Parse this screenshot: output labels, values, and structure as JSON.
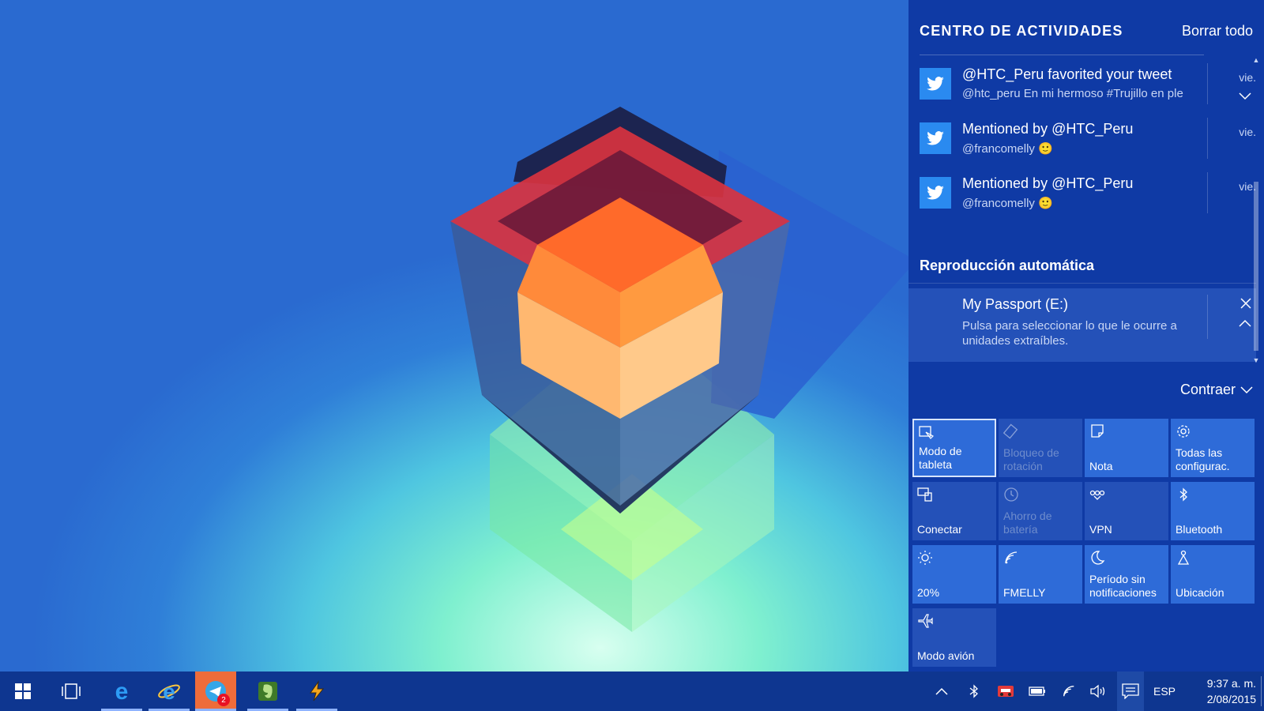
{
  "action_center": {
    "title": "CENTRO DE ACTIVIDADES",
    "clear_all": "Borrar todo",
    "notifications": [
      {
        "app_icon": "twitter-icon",
        "title": "@HTC_Peru favorited your tweet",
        "body": "@htc_peru En mi hermoso #Trujillo en ple",
        "time": "vie."
      },
      {
        "app_icon": "twitter-icon",
        "title": "Mentioned by @HTC_Peru",
        "body": "@francomelly 🙂",
        "time": "vie."
      },
      {
        "app_icon": "twitter-icon",
        "title": "Mentioned by @HTC_Peru",
        "body": "@francomelly 🙂",
        "time": "vie."
      }
    ],
    "autoplay_section": "Reproducción automática",
    "autoplay": {
      "title": "My Passport (E:)",
      "body": "Pulsa para seleccionar lo que le ocurre a unidades extraíbles."
    },
    "collapse": "Contraer",
    "quick_actions": [
      {
        "label": "Modo de tableta",
        "icon": "tablet-mode-icon",
        "state": "on"
      },
      {
        "label": "Bloqueo de rotación",
        "icon": "rotation-lock-icon",
        "state": "disabled"
      },
      {
        "label": "Nota",
        "icon": "note-icon",
        "state": "on"
      },
      {
        "label": "Todas las configurac.",
        "icon": "settings-gear-icon",
        "state": "on"
      },
      {
        "label": "Conectar",
        "icon": "connect-icon",
        "state": "off"
      },
      {
        "label": "Ahorro de batería",
        "icon": "battery-saver-icon",
        "state": "disabled"
      },
      {
        "label": "VPN",
        "icon": "vpn-icon",
        "state": "off"
      },
      {
        "label": "Bluetooth",
        "icon": "bluetooth-icon",
        "state": "on"
      },
      {
        "label": "20%",
        "icon": "brightness-icon",
        "state": "on"
      },
      {
        "label": "FMELLY",
        "icon": "wifi-icon",
        "state": "on"
      },
      {
        "label": "Período sin notificaciones",
        "icon": "quiet-hours-moon-icon",
        "state": "on"
      },
      {
        "label": "Ubicación",
        "icon": "location-icon",
        "state": "on"
      },
      {
        "label": "Modo avión",
        "icon": "airplane-icon",
        "state": "off"
      }
    ]
  },
  "taskbar": {
    "apps": [
      {
        "name": "start-button",
        "icon": "windows-logo-icon"
      },
      {
        "name": "task-view-button",
        "icon": "task-view-icon"
      },
      {
        "name": "edge",
        "icon": "edge-icon"
      },
      {
        "name": "internet-explorer",
        "icon": "internet-explorer-icon"
      },
      {
        "name": "telegram",
        "icon": "telegram-icon",
        "badge": "2"
      },
      {
        "name": "evernote",
        "icon": "evernote-icon"
      },
      {
        "name": "winamp",
        "icon": "winamp-icon"
      }
    ],
    "language": "ESP",
    "time": "9:37 a. m.",
    "date": "2/08/2015"
  },
  "colors": {
    "action_center_bg": "#0f3aa5",
    "tile_on": "#2e6bd8",
    "tile_off": "#2451b8",
    "taskbar_bg": "#0e3690",
    "twitter_blue": "#2a8af0",
    "active_app": "#ee6c3a"
  }
}
